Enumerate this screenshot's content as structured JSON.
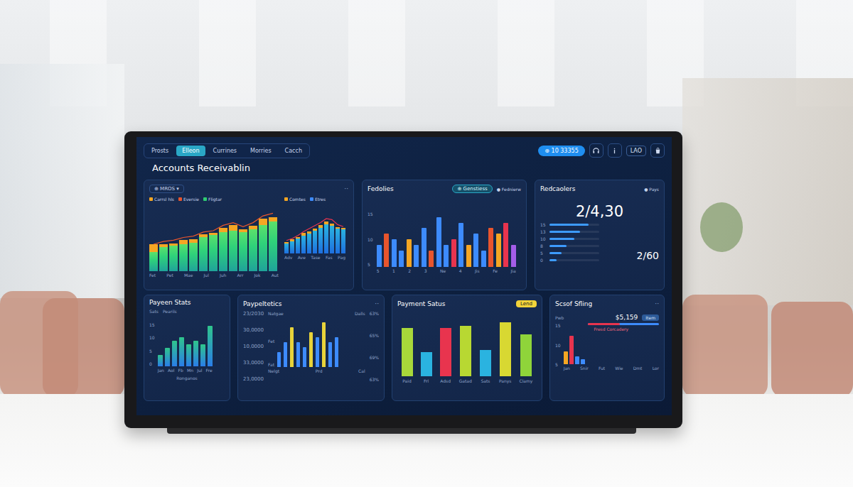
{
  "nav": {
    "tabs": [
      {
        "label": "Prosts",
        "selected": false
      },
      {
        "label": "Elleon",
        "selected": true
      },
      {
        "label": "Currines",
        "selected": false
      },
      {
        "label": "Morries",
        "selected": false
      },
      {
        "label": "Cacch",
        "selected": false
      }
    ],
    "pill": "⊕ 10 33355",
    "badge": "LAO"
  },
  "title": "Accounts Receivablin",
  "trend": {
    "dropdown": "⊕ MROS ▾",
    "menu": "··",
    "left": {
      "legend": [
        {
          "label": "Carrsl hls",
          "color": "#f5a623"
        },
        {
          "label": "Eversie",
          "color": "#e8552d"
        },
        {
          "label": "Fligtar",
          "color": "#2ecc71"
        }
      ],
      "base": [
        28,
        36,
        38,
        40,
        42,
        50,
        54,
        58,
        60,
        58,
        62,
        68,
        74
      ],
      "cap": [
        12,
        4,
        3,
        6,
        5,
        4,
        3,
        6,
        8,
        4,
        5,
        9,
        6
      ],
      "line": [
        40,
        44,
        46,
        50,
        52,
        58,
        60,
        68,
        72,
        66,
        72,
        82,
        86
      ],
      "x_labels": [
        "Fet",
        "Pet",
        "Mae",
        "Jul",
        "Juh",
        "Arr",
        "Jok",
        "Aut"
      ]
    },
    "right": {
      "legend": [
        {
          "label": "Comtes",
          "color": "#f5a623"
        },
        {
          "label": "Etres",
          "color": "#3d8bfd"
        }
      ],
      "base": [
        20,
        24,
        30,
        36,
        40,
        46,
        52,
        58,
        56,
        50,
        48
      ],
      "cap": [
        3,
        4,
        3,
        5,
        4,
        4,
        5,
        6,
        4,
        3,
        3
      ],
      "line": [
        26,
        30,
        36,
        44,
        50,
        56,
        62,
        70,
        68,
        58,
        54
      ],
      "x_labels": [
        "Adv",
        "Ave",
        "Tase",
        "Fas",
        "Pag"
      ]
    }
  },
  "fedolies": {
    "title": "Fedolies",
    "pill": "⊕ Genstiess",
    "legend": "● Fednierw",
    "y_ticks": [
      "15",
      "10",
      "5"
    ],
    "bars": [
      {
        "value": 4,
        "color": "#3d8bfd"
      },
      {
        "value": 6,
        "color": "#e8552d"
      },
      {
        "value": 5,
        "color": "#3d8bfd"
      },
      {
        "value": 3,
        "color": "#3d8bfd"
      },
      {
        "value": 5,
        "color": "#f5a623"
      },
      {
        "value": 4,
        "color": "#3d8bfd"
      },
      {
        "value": 7,
        "color": "#3d8bfd"
      },
      {
        "value": 3,
        "color": "#e8552d"
      },
      {
        "value": 9,
        "color": "#3d8bfd"
      },
      {
        "value": 4,
        "color": "#3d8bfd"
      },
      {
        "value": 5,
        "color": "#e8344e"
      },
      {
        "value": 8,
        "color": "#3d8bfd"
      },
      {
        "value": 4,
        "color": "#f5a623"
      },
      {
        "value": 6,
        "color": "#3d8bfd"
      },
      {
        "value": 3,
        "color": "#3d8bfd"
      },
      {
        "value": 7,
        "color": "#e8552d"
      },
      {
        "value": 6,
        "color": "#f5a623"
      },
      {
        "value": 8,
        "color": "#e8344e"
      },
      {
        "value": 4,
        "color": "#a45de8"
      }
    ],
    "x_labels": [
      "5",
      "1",
      "2",
      "3",
      "Ne",
      "4",
      "Jis",
      "Fe",
      "Jia"
    ]
  },
  "receivables": {
    "title": "Redcaolers",
    "legend": "● Pays",
    "total": "2/4,30",
    "rows": [
      {
        "label": "15",
        "level": 0.78
      },
      {
        "label": "13",
        "level": 0.62
      },
      {
        "label": "10",
        "level": 0.5
      },
      {
        "label": "8",
        "level": 0.34
      },
      {
        "label": "5",
        "level": 0.24
      },
      {
        "label": "0",
        "level": 0.14
      }
    ],
    "sub": "2/60"
  },
  "payee": {
    "title": "Payeen Stats",
    "legend": [
      "Sats",
      "Pearils"
    ],
    "y_ticks": [
      "15",
      "10",
      "5",
      "0"
    ],
    "values": [
      3,
      5,
      7,
      8,
      6,
      7,
      6,
      11
    ],
    "x_labels": [
      "Jan",
      "Aol",
      "Fb",
      "Mn",
      "Jul",
      "Fre"
    ],
    "footer": "Ronganos"
  },
  "metrics": {
    "title": "Paypeltetics",
    "menu": "··",
    "columns": [
      "Natgae",
      "Dalls"
    ],
    "y_ticks": [
      "23/2030",
      "30,0000",
      "10,0000",
      "33,0000",
      "23,0000"
    ],
    "side": [
      "Fet",
      "Fat"
    ],
    "pcts": [
      "63%",
      "65%",
      "69%",
      "63%"
    ],
    "bars": [
      {
        "value": 3,
        "color": "#3d8bfd"
      },
      {
        "value": 5,
        "color": "#3d8bfd"
      },
      {
        "value": 8,
        "color": "#e8d33a"
      },
      {
        "value": 5,
        "color": "#3d8bfd"
      },
      {
        "value": 4,
        "color": "#3d8bfd"
      },
      {
        "value": 7,
        "color": "#e8d33a"
      },
      {
        "value": 6,
        "color": "#3d8bfd"
      },
      {
        "value": 9,
        "color": "#e8d33a"
      },
      {
        "value": 5,
        "color": "#3d8bfd"
      },
      {
        "value": 6,
        "color": "#3d8bfd"
      }
    ],
    "x_labels": [
      "Nelgt",
      "Prd",
      "Cal"
    ]
  },
  "status": {
    "title": "Payment Satus",
    "badge": "Lend",
    "bars": [
      {
        "label": "Paid",
        "value": 7,
        "color": "#a8d83a"
      },
      {
        "label": "Frl",
        "value": 3.5,
        "color": "#2ab3e0"
      },
      {
        "label": "Adsd",
        "value": 7,
        "color": "#e8344e"
      },
      {
        "label": "Gatad",
        "value": 7.3,
        "color": "#b8d832"
      },
      {
        "label": "Sats",
        "value": 3.8,
        "color": "#2ab3e0"
      },
      {
        "label": "Panys",
        "value": 7.8,
        "color": "#d8d832"
      },
      {
        "label": "Clamy",
        "value": 6,
        "color": "#8fd43a"
      }
    ]
  },
  "spending": {
    "title": "Scsof Sfling",
    "menu": "··",
    "label": "Pwb",
    "amount": "$5,159",
    "badge": "Item",
    "y_ticks": [
      "15",
      "10",
      "5"
    ],
    "split_level": 0.45,
    "note": "Fresd Corcadery",
    "bars": [
      {
        "value": 5,
        "color": "#f5a623"
      },
      {
        "value": 11,
        "color": "#e8344e"
      },
      {
        "value": 3,
        "color": "#3d8bfd"
      },
      {
        "value": 2,
        "color": "#3d8bfd"
      }
    ],
    "x_labels": [
      "Jan",
      "Snir",
      "Fut",
      "Wie",
      "Dmt",
      "Lor"
    ]
  }
}
